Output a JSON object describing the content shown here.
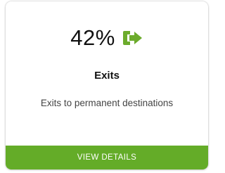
{
  "card": {
    "value": "42%",
    "icon": "exit-arrow-icon",
    "title": "Exits",
    "description": "Exits to permanent destinations",
    "action_label": "VIEW DETAILS"
  },
  "colors": {
    "accent": "#64ac28",
    "icon": "#6cab2c",
    "text": "#111111",
    "muted_text": "#444444"
  }
}
